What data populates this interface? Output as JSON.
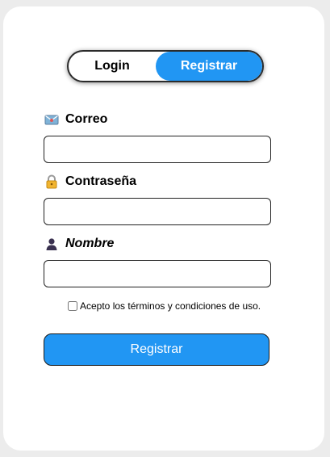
{
  "toggle": {
    "login_label": "Login",
    "register_label": "Registrar",
    "active": "register"
  },
  "fields": {
    "email": {
      "label": "Correo",
      "icon": "envelope-icon",
      "value": "",
      "placeholder": ""
    },
    "password": {
      "label": "Contraseña",
      "icon": "lock-icon",
      "value": "",
      "placeholder": ""
    },
    "name": {
      "label": "Nombre",
      "icon": "user-icon",
      "value": "",
      "placeholder": ""
    }
  },
  "terms": {
    "label": "Acepto los términos y condiciones de uso.",
    "checked": false
  },
  "submit": {
    "label": "Registrar"
  },
  "colors": {
    "accent": "#2196f3",
    "card": "#ffffff",
    "background": "#ececec"
  }
}
